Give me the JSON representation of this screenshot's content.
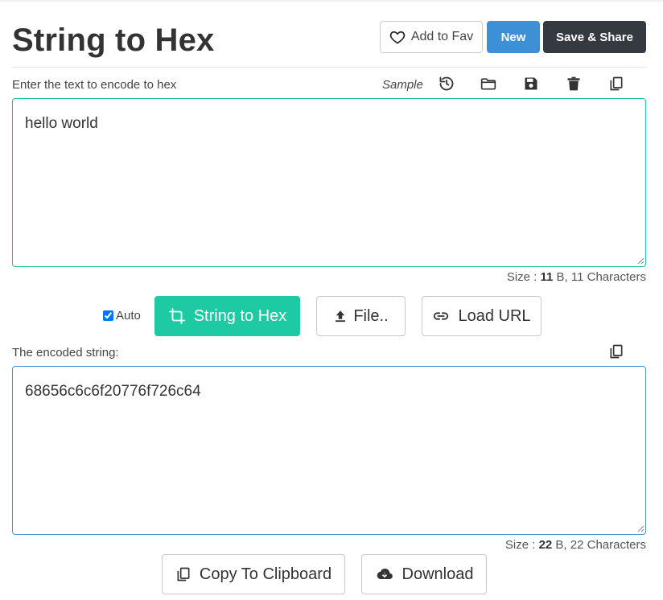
{
  "header": {
    "title": "String to Hex",
    "fav_label": "Add to Fav",
    "new_label": "New",
    "save_label": "Save & Share"
  },
  "input": {
    "label": "Enter the text to encode to hex",
    "sample_label": "Sample",
    "value": "hello world",
    "size_bytes": "11",
    "size_unit": "B,",
    "size_chars": "11 Characters",
    "size_prefix": "Size :",
    "toolbar_icons": [
      "history-icon",
      "folder-icon",
      "save-icon",
      "trash-icon",
      "copy-icon"
    ]
  },
  "actions": {
    "auto_label": "Auto",
    "auto_checked": true,
    "convert_label": "String to Hex",
    "file_label": "File..",
    "url_label": "Load URL"
  },
  "output": {
    "label": "The encoded string:",
    "value": "68656c6c6f20776f726c64",
    "size_prefix": "Size :",
    "size_bytes": "22",
    "size_unit": "B,",
    "size_chars": "22 Characters"
  },
  "footer": {
    "copy_label": "Copy To Clipboard",
    "download_label": "Download"
  },
  "colors": {
    "accent_green": "#1ecaa3",
    "new_blue": "#3d8fd6",
    "dark": "#343a40",
    "input_border": "#1fbf9f",
    "output_border": "#4a8fc9"
  }
}
